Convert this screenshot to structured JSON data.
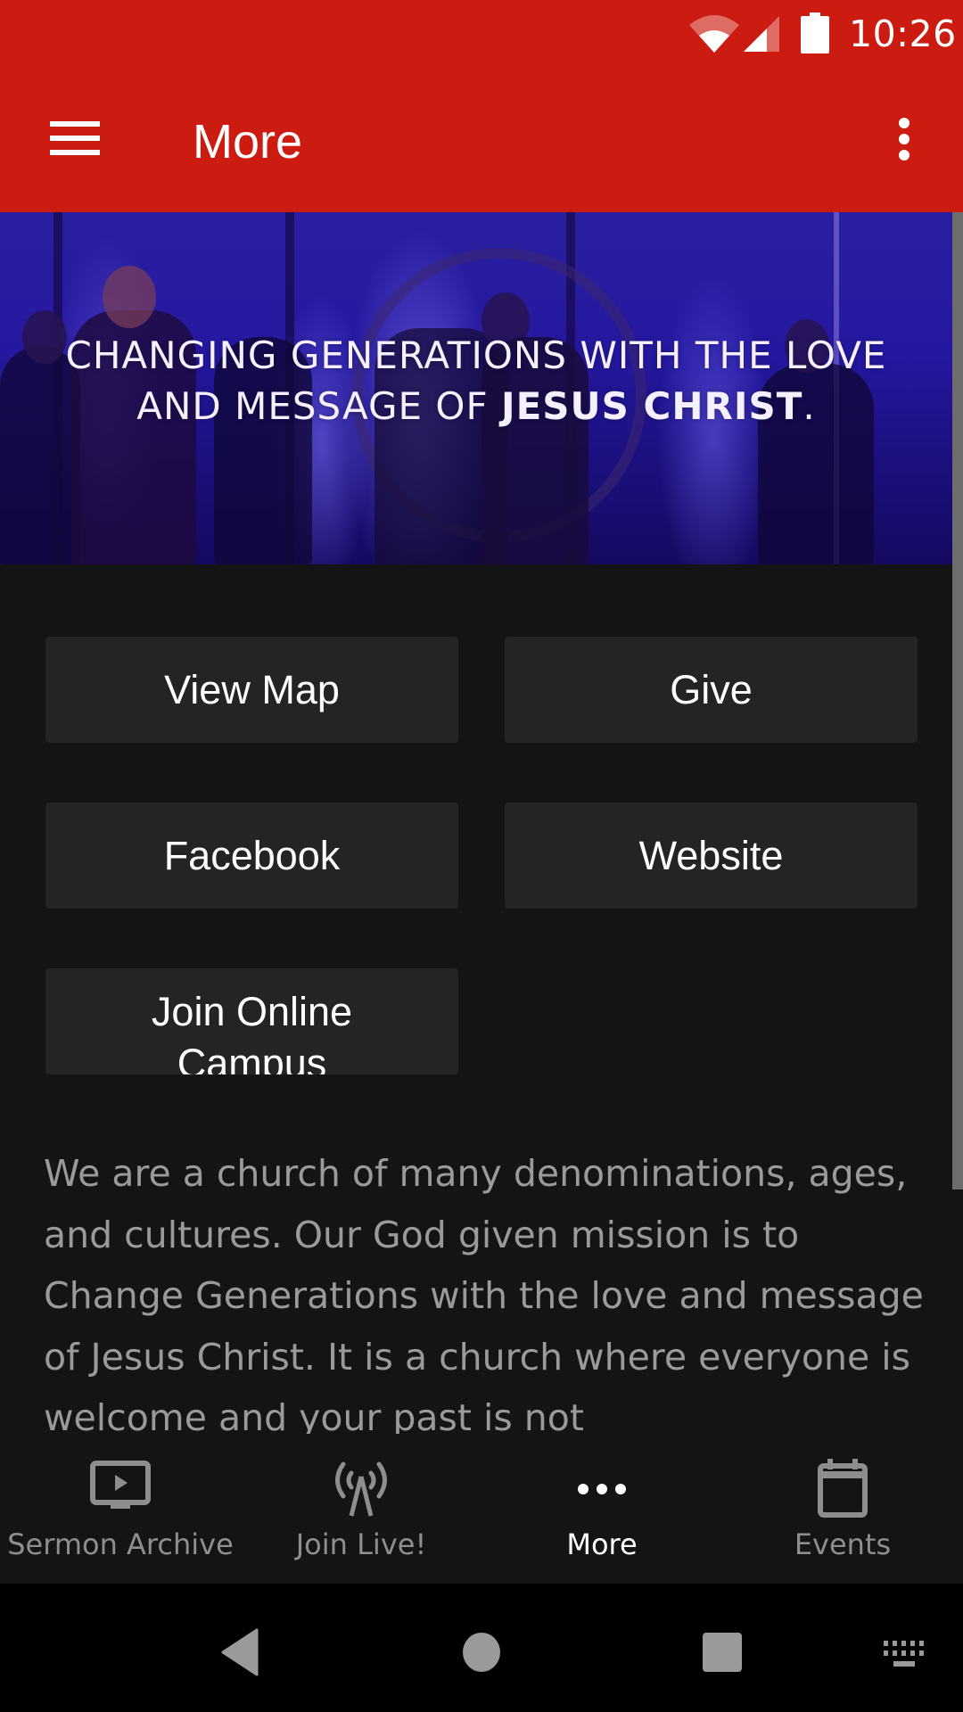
{
  "status_bar": {
    "time": "10:26",
    "icons": [
      "wifi-icon",
      "cell-signal-icon",
      "battery-icon"
    ]
  },
  "toolbar": {
    "title": "More",
    "menu_icon": "hamburger-menu-icon",
    "overflow_icon": "overflow-menu-icon",
    "color": "#cc1c11"
  },
  "banner": {
    "line1": "CHANGING GENERATIONS WITH THE LOVE",
    "line2_prefix": "AND MESSAGE OF ",
    "line2_bold": "JESUS CHRIST",
    "line2_suffix": "."
  },
  "buttons": [
    {
      "label": "View Map"
    },
    {
      "label": "Give"
    },
    {
      "label": "Facebook"
    },
    {
      "label": "Website"
    },
    {
      "label_lines": [
        "Join Online",
        "Campus"
      ]
    }
  ],
  "description": "We are a church of many denominations, ages, and cultures. Our God given mission is to Change Generations with the love and message of Jesus Christ. It is a church where everyone is welcome and your past is not",
  "bottom_nav": {
    "tabs": [
      {
        "label": "Sermon Archive",
        "icon": "tv-play-icon",
        "active": false
      },
      {
        "label": "Join Live!",
        "icon": "broadcast-antenna-icon",
        "active": false
      },
      {
        "label": "More",
        "icon": "more-dots-icon",
        "active": true
      },
      {
        "label": "Events",
        "icon": "calendar-icon",
        "active": false
      }
    ]
  },
  "system_nav": {
    "keys": [
      "back-icon",
      "home-icon",
      "recents-icon",
      "keyboard-icon"
    ]
  },
  "colors": {
    "accent_red": "#cc1c11",
    "background": "#131416",
    "button_bg": "#232425",
    "muted_text": "#9a9a9c",
    "inactive_icon": "#8e8e90"
  }
}
